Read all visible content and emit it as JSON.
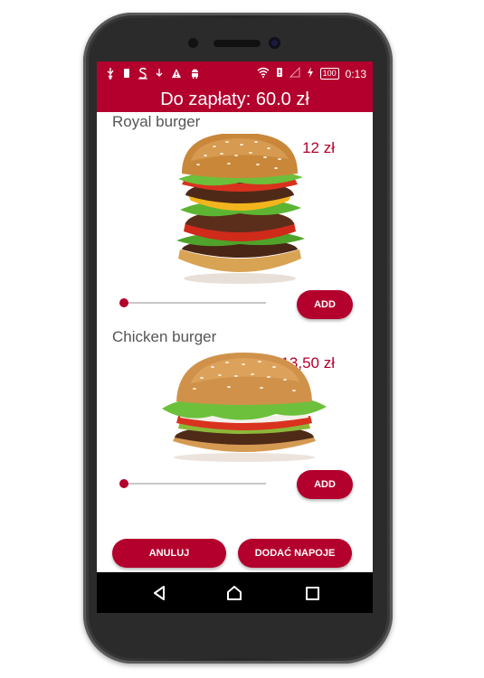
{
  "status_bar": {
    "left_icons": [
      "usb-icon",
      "sim-icon",
      "s-icon",
      "download-icon",
      "warning-icon",
      "android-icon"
    ],
    "right_icons": [
      "wifi-icon",
      "no-sim-icon",
      "signal-icon",
      "charging-icon"
    ],
    "battery": "100",
    "time": "0:13"
  },
  "header": {
    "title": "Do zapłaty: 60.0 zł"
  },
  "products": [
    {
      "name": "Royal burger",
      "price": "12 zł",
      "quantity": 0,
      "add_label": "ADD"
    },
    {
      "name": "Chicken burger",
      "price": "13,50 zł",
      "quantity": 0,
      "add_label": "ADD"
    }
  ],
  "actions": {
    "cancel_label": "ANULUJ",
    "drinks_label": "DODAĆ NAPOJE"
  },
  "colors": {
    "accent": "#b3002c",
    "navbar": "#000000",
    "phone_body": "#2b2b2b"
  }
}
